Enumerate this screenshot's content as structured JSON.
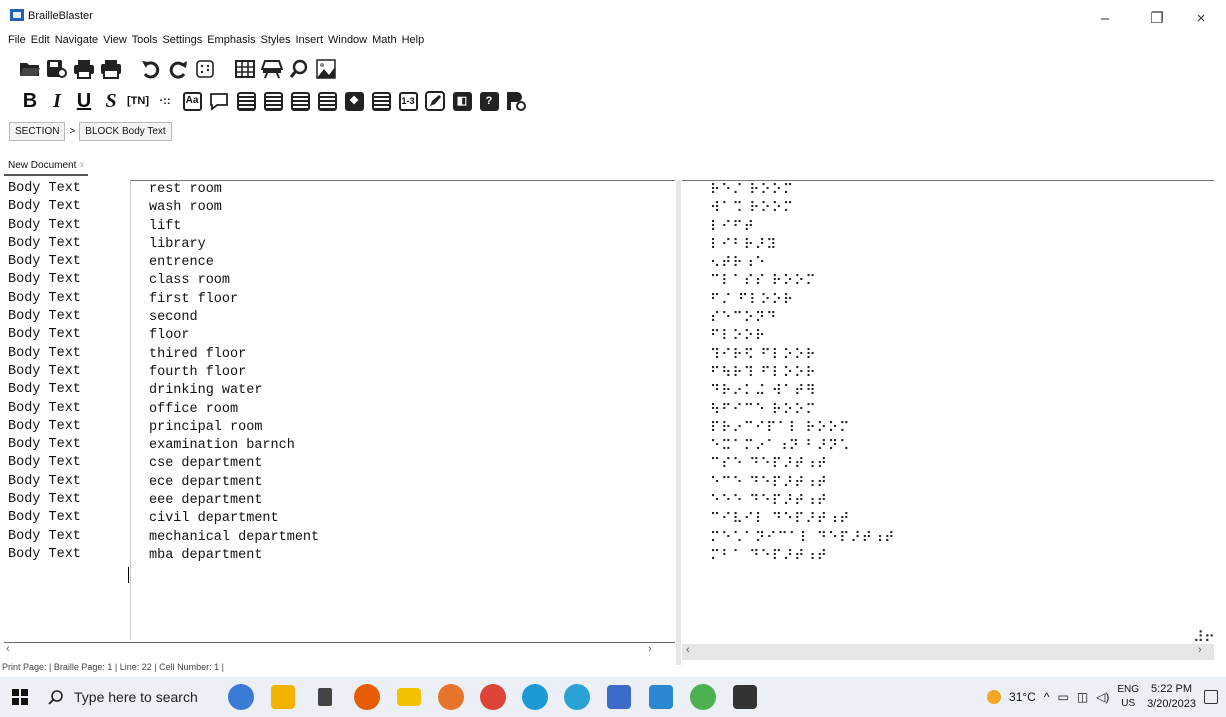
{
  "window": {
    "title": "BrailleBlaster",
    "minimize": "–",
    "maximize": "❐",
    "close": "×"
  },
  "menu": [
    "File",
    "Edit",
    "Navigate",
    "View",
    "Tools",
    "Settings",
    "Emphasis",
    "Styles",
    "Insert",
    "Window",
    "Math",
    "Help"
  ],
  "toolbar_row2": {
    "bold": "B",
    "italic": "I",
    "underline": "U",
    "script": "S",
    "tn": "[TN]",
    "braille_dots": "·::",
    "aa": "Aa",
    "numbered": "1-3"
  },
  "breadcrumb": {
    "section": "SECTION",
    "separator": ">",
    "block": "BLOCK Body Text"
  },
  "document_tab": {
    "label": "New Document",
    "close": "☓"
  },
  "style_labels": [
    "Body Text",
    "Body Text",
    "Body Text",
    "Body Text",
    "Body Text",
    "Body Text",
    "Body Text",
    "Body Text",
    "Body Text",
    "Body Text",
    "Body Text",
    "Body Text",
    "Body Text",
    "Body Text",
    "Body Text",
    "Body Text",
    "Body Text",
    "Body Text",
    "Body Text",
    "Body Text",
    "Body Text"
  ],
  "print_lines": [
    "rest room",
    "wash room",
    "lift",
    "library",
    "entrence",
    "class room",
    "first floor",
    "second",
    "floor",
    "thired floor",
    "fourth floor",
    "drinking water",
    "office room",
    "principal room",
    "examination barnch",
    "cse department",
    "ece department",
    "eee department",
    "civil department",
    "mechanical department",
    "mba department"
  ],
  "braille_lines": [
    "⠗⠑⠌ ⠗⠕⠕⠍",
    "⠺⠁⠩ ⠗⠕⠕⠍",
    "⠇⠊⠋⠞",
    "⠇⠊⠃⠗⠜⠽",
    "⠢⠞⠗⠰⠑",
    "⠉⠇⠁⠎⠎ ⠗⠕⠕⠍",
    "⠋⠌ ⠋⠇⠕⠕⠗",
    "⠎⠑⠉⠕⠝⠙",
    "⠋⠇⠕⠕⠗",
    "⠹⠊⠗⠫ ⠋⠇⠕⠕⠗",
    "⠋⠳⠗⠹ ⠋⠇⠕⠕⠗",
    "⠙⠗⠔⠅⠬ ⠺⠁⠞⠻",
    "⠳⠋⠊⠉⠑ ⠗⠕⠕⠍",
    "⠏⠗⠔⠉⠊⠏⠁⠇ ⠗⠕⠕⠍",
    "⠑⠭⠁⠍⠔⠁⠰⠝ ⠃⠜⠝⠡",
    "⠉⠎⠑ ⠙⠑⠏⠜⠞⠰⠞",
    "⠑⠉⠑ ⠙⠑⠏⠜⠞⠰⠞",
    "⠑⠑⠑ ⠙⠑⠏⠜⠞⠰⠞",
    "⠉⠊⠧⠊⠇ ⠙⠑⠏⠜⠞⠰⠞",
    "⠍⠑⠡⠁⠝⠊⠉⠁⠇ ⠙⠑⠏⠜⠞⠰⠞",
    "⠍⠃⠁ ⠙⠑⠏⠜⠞⠰⠞"
  ],
  "corner_glyph": "⠼⠖",
  "status_bar": "Print Page: | Braille Page: 1 | Line: 22 | Cell Number: 1 |",
  "taskbar": {
    "search_placeholder": "Type here to search",
    "weather": "31°C",
    "language_top": "ENG",
    "language_bottom": "US",
    "time": "5:22 PM",
    "date": "3/20/2023",
    "app_colors": [
      "#3a7bd5",
      "#f3b300",
      "#444444",
      "#e65c00",
      "#f2c200",
      "#e5752a",
      "#db4437",
      "#1b9ad6",
      "#2aa2d6",
      "#3b6cc7",
      "#2b87d1",
      "#4caf50",
      "#333333"
    ]
  },
  "colors": {
    "taskbar_bg": "#eceff6",
    "brand": "#1f63b8"
  }
}
